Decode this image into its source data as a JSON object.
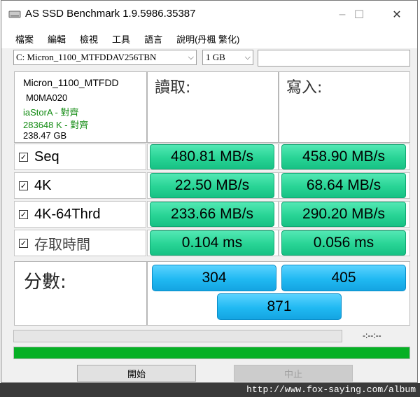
{
  "window": {
    "title": "AS SSD Benchmark 1.9.5986.35387",
    "minimize": "–",
    "maximize": "☐",
    "close": "✕"
  },
  "menu": [
    "檔案",
    "編輯",
    "檢視",
    "工具",
    "語言",
    "說明(丹楓 繁化)"
  ],
  "toolbar": {
    "drive": "C: Micron_1100_MTFDDAV256TBN",
    "size": "1 GB",
    "text_value": ""
  },
  "drive_info": {
    "model": "Micron_1100_MTFDD",
    "firmware": "M0MA020",
    "driver": "iaStorA - 對齊",
    "alignment": "283648 K - 對齊",
    "capacity": "238.47 GB"
  },
  "columns": {
    "read": "讀取:",
    "write": "寫入:"
  },
  "rows": [
    {
      "label": "Seq",
      "checked": true,
      "read": "480.81 MB/s",
      "write": "458.90 MB/s"
    },
    {
      "label": "4K",
      "checked": true,
      "read": "22.50 MB/s",
      "write": "68.64 MB/s"
    },
    {
      "label": "4K-64Thrd",
      "checked": true,
      "read": "233.66 MB/s",
      "write": "290.20 MB/s"
    },
    {
      "label": "存取時間",
      "checked": true,
      "read": "0.104 ms",
      "write": "0.056 ms"
    }
  ],
  "score": {
    "label": "分數:",
    "read": "304",
    "write": "405",
    "total": "871"
  },
  "status": {
    "timer": "-:--:--",
    "progress": 1.0
  },
  "buttons": {
    "start": "開始",
    "stop": "中止"
  },
  "footer": "http://www.fox-saying.com/album",
  "colors": {
    "value_green": "#28d495",
    "score_blue": "#20b9f2",
    "progress_green": "#06b025"
  },
  "icons": {
    "app": "drive-icon",
    "check": "checkbox-icon"
  }
}
